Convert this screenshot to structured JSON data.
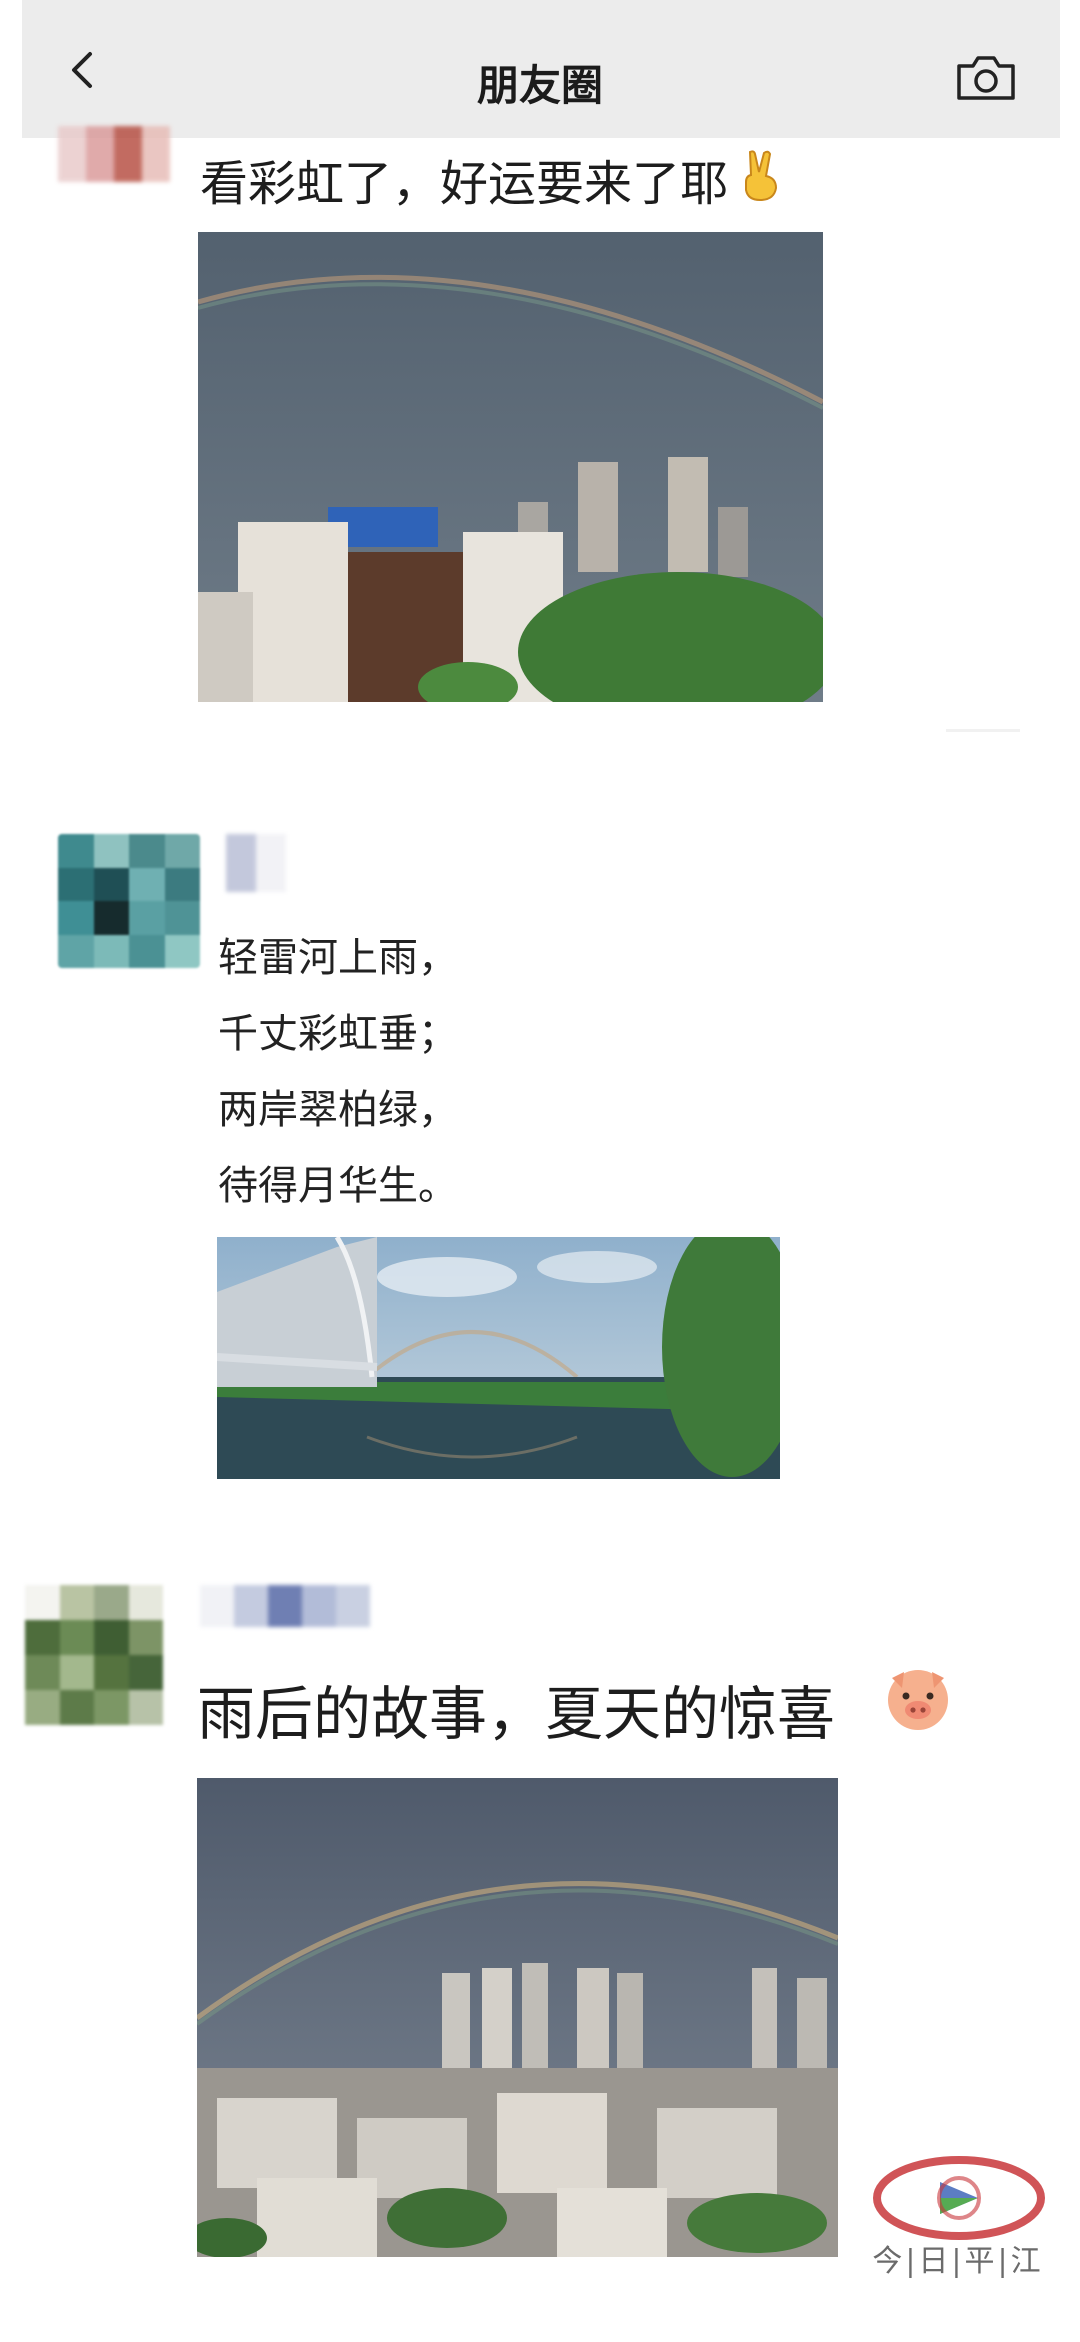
{
  "header": {
    "title": "朋友圈",
    "back_icon": "chevron-left-icon",
    "camera_icon": "camera-icon"
  },
  "posts": [
    {
      "text": "看彩虹了，好运要来了耶",
      "emoji": "victory-hand-emoji",
      "image": "rainbow-over-city-buildings"
    },
    {
      "poem": [
        "轻雷河上雨，",
        "千丈彩虹垂；",
        "两岸翠柏绿，",
        "待得月华生。"
      ],
      "image": "rainbow-over-river-bridge"
    },
    {
      "text": "雨后的故事，夏天的惊喜",
      "emoji": "pig-face-emoji",
      "image": "rainbow-over-city-skyline"
    }
  ],
  "watermark": {
    "text": "今|日|平|江",
    "colors": {
      "red": "#c8363a",
      "blue": "#3f66b8",
      "green": "#55b33f"
    }
  }
}
